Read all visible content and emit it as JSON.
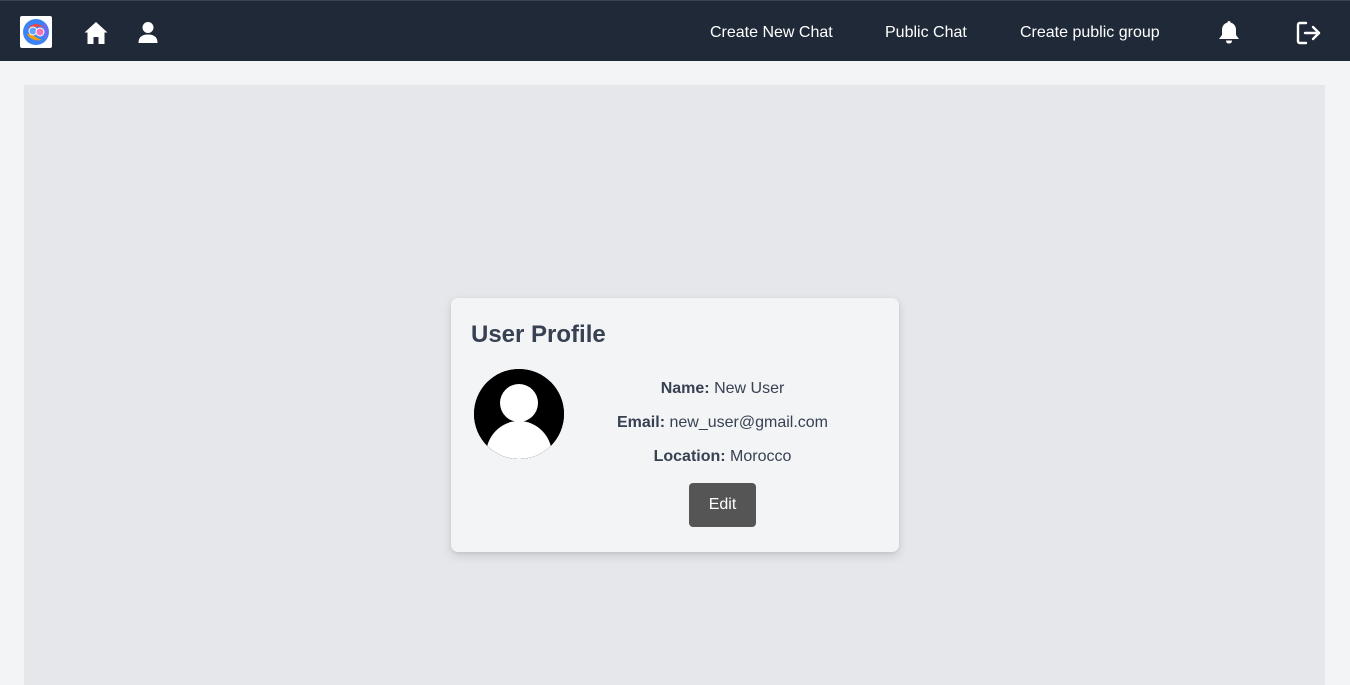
{
  "navbar": {
    "logo_icon": "chat-app-logo-icon",
    "home_icon": "home-icon",
    "profile_icon": "user-icon",
    "links": [
      {
        "label": "Create New Chat"
      },
      {
        "label": "Public Chat"
      },
      {
        "label": "Create public group"
      }
    ],
    "notification_icon": "bell-icon",
    "logout_icon": "logout-icon",
    "background_color": "#1f2937"
  },
  "profile": {
    "title": "User Profile",
    "avatar_icon": "default-avatar-icon",
    "name_label": "Name:",
    "name_value": "New User",
    "email_label": "Email:",
    "email_value": "new_user@gmail.com",
    "location_label": "Location:",
    "location_value": "Morocco",
    "edit_label": "Edit",
    "edit_button_color": "#555555"
  }
}
